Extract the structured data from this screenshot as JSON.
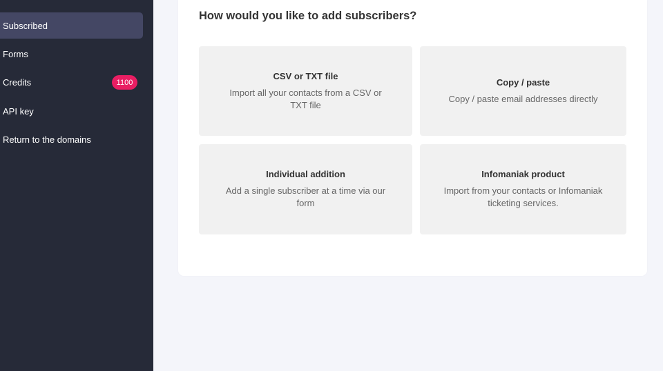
{
  "sidebar": {
    "items": [
      {
        "label": "Subscribed",
        "active": true
      },
      {
        "label": "Forms"
      },
      {
        "label": "Credits",
        "badge": "1100"
      },
      {
        "label": "API key"
      },
      {
        "label": "Return to the domains"
      }
    ]
  },
  "main": {
    "title": "How would you like to add subscribers?",
    "options": [
      {
        "title": "CSV or TXT file",
        "description": "Import all your contacts from a CSV or TXT file"
      },
      {
        "title": "Copy / paste",
        "description": "Copy / paste email addresses directly"
      },
      {
        "title": "Individual addition",
        "description": "Add a single subscriber at a time via our form"
      },
      {
        "title": "Infomaniak product",
        "description": "Import from your contacts or Infomaniak ticketing services."
      }
    ]
  },
  "colors": {
    "sidebar_bg": "#262a38",
    "active_item_bg": "#444764",
    "badge_bg": "#e91e63",
    "card_bg": "#f1f1f1",
    "page_bg": "#f4f5fa"
  }
}
